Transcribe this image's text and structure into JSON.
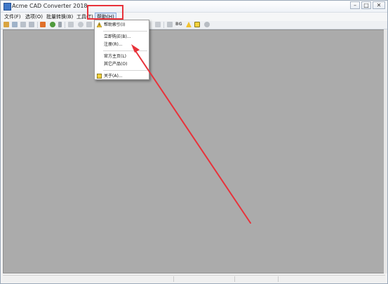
{
  "window": {
    "title": "Acme CAD Converter 2018"
  },
  "window_buttons": {
    "minimize": "–",
    "maximize": "□",
    "close": "✕"
  },
  "menubar": {
    "items": [
      {
        "label": "文件(F)"
      },
      {
        "label": "选项(O)"
      },
      {
        "label": "批量转换(B)"
      },
      {
        "label": "工具(T)"
      },
      {
        "label": "帮助(H)"
      }
    ]
  },
  "toolbar": {
    "bg_label": "BG"
  },
  "help_menu": {
    "items": [
      {
        "label": "帮助索引(I)",
        "icon": "warning-icon"
      },
      {
        "label": "立即购买(B)..."
      },
      {
        "label": "注册(R)..."
      },
      {
        "label": "官方主页(L)"
      },
      {
        "label": "其它产品(O)"
      },
      {
        "label": "关于(A)...",
        "icon": "info-icon"
      }
    ]
  },
  "colors": {
    "annotation": "#e8323a",
    "canvas": "#ababab",
    "menu_active": "#dfe9f8"
  }
}
